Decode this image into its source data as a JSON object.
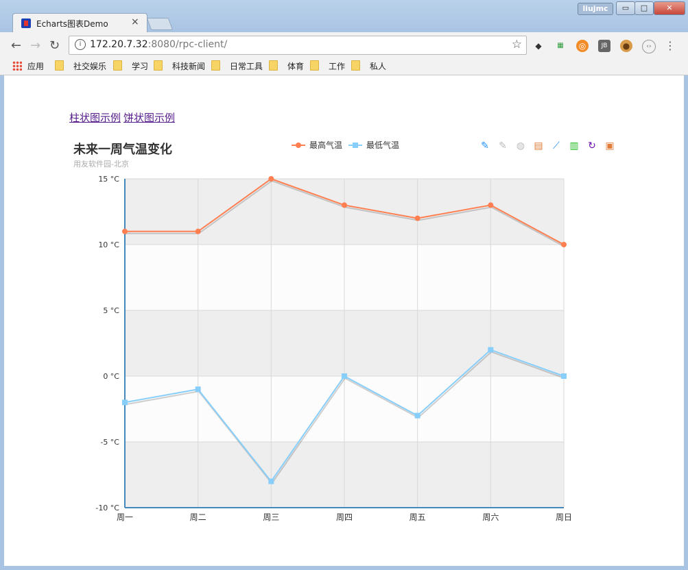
{
  "browser": {
    "tab_title": "Echarts图表Demo",
    "tab_close": "×",
    "user_badge": "liujmc",
    "url_host": "172.20.7.32",
    "url_rest": ":8080/rpc-client/",
    "min_label": "▭",
    "max_label": "□",
    "close_label": "✕"
  },
  "bookmarks": [
    {
      "label": "应用"
    },
    {
      "label": "社交娱乐"
    },
    {
      "label": "学习"
    },
    {
      "label": "科技新闻"
    },
    {
      "label": "日常工具"
    },
    {
      "label": "体育"
    },
    {
      "label": "工作"
    },
    {
      "label": "私人"
    }
  ],
  "page": {
    "link_bar": "柱状图示例",
    "link_pie": "饼状图示例"
  },
  "toolbox": [
    "mark-icon",
    "mark-undo-icon",
    "mark-clear-icon",
    "data-view-icon",
    "line-chart-icon",
    "bar-chart-icon",
    "restore-icon",
    "save-image-icon"
  ],
  "chart_data": {
    "type": "line",
    "title": "未来一周气温变化",
    "subtitle": "用友软件园-北京",
    "categories": [
      "周一",
      "周二",
      "周三",
      "周四",
      "周五",
      "周六",
      "周日"
    ],
    "series": [
      {
        "name": "最高气温",
        "values": [
          11,
          11,
          15,
          13,
          12,
          13,
          10
        ],
        "color": "#ff7f50"
      },
      {
        "name": "最低气温",
        "values": [
          -2,
          -1,
          -8,
          0,
          -3,
          2,
          0
        ],
        "color": "#87cefa"
      }
    ],
    "ylim": [
      -10,
      15
    ],
    "yticks": [
      "15 °C",
      "10 °C",
      "5 °C",
      "0 °C",
      "-5 °C",
      "-10 °C"
    ],
    "grid": true,
    "legend_position": "top-center"
  }
}
